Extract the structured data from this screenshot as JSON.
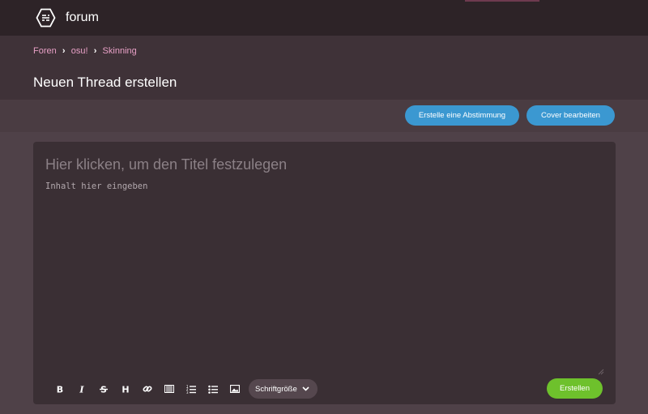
{
  "topbar": {
    "title": "forum"
  },
  "breadcrumb": {
    "items": [
      "Foren",
      "osu!",
      "Skinning"
    ]
  },
  "page": {
    "title": "Neuen Thread erstellen"
  },
  "actions": {
    "poll_label": "Erstelle eine Abstimmung",
    "cover_label": "Cover bearbeiten"
  },
  "editor": {
    "title_placeholder": "Hier klicken, um den Titel festzulegen",
    "body_placeholder": "Inhalt hier eingeben",
    "toolbar": {
      "buttons": [
        "bold-icon",
        "italic-icon",
        "strikethrough-icon",
        "heading-icon",
        "link-icon",
        "spoiler-icon",
        "ordered-list-icon",
        "unordered-list-icon",
        "image-icon"
      ],
      "font_size_label": "Schriftgröße"
    },
    "submit_label": "Erstellen"
  },
  "colors": {
    "accent_blue": "#3b98d1",
    "accent_green": "#6ec12c",
    "link_pink": "#e8a0c6"
  }
}
